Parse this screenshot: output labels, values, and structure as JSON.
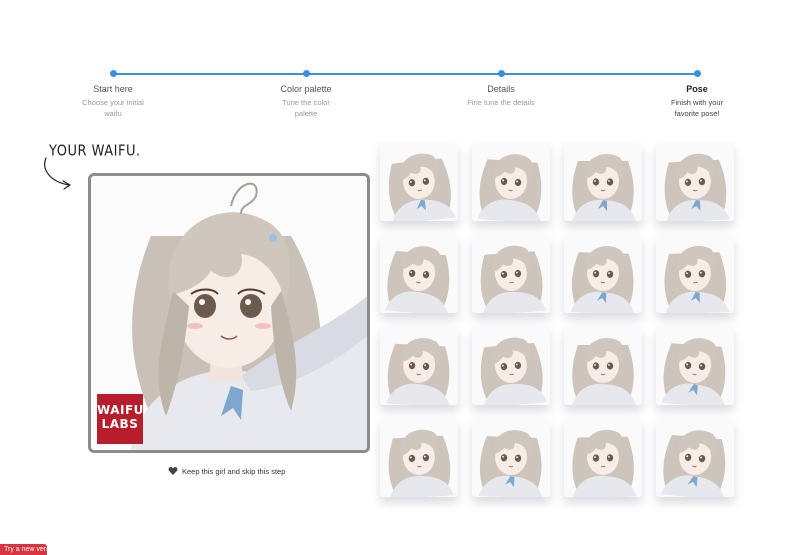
{
  "stepper": {
    "steps": [
      {
        "title": "Start here",
        "desc": "Choose your initial waifu",
        "active": false
      },
      {
        "title": "Color palette",
        "desc": "Tune the color palette",
        "active": false
      },
      {
        "title": "Details",
        "desc": "Fine tune the details",
        "active": false
      },
      {
        "title": "Pose",
        "desc": "Finish with your favorite pose!",
        "active": true
      }
    ],
    "accent_color": "#3a8ee6"
  },
  "heading": "YOUR WAIFU.",
  "portrait": {
    "logo_line1": "WAIFU",
    "logo_line2": "LABS",
    "logo_color": "#b81d2b"
  },
  "keep_action": {
    "icon": "heart-icon",
    "label": "Keep this girl and skip this step"
  },
  "pose_grid": {
    "rows": 4,
    "cols": 4,
    "count": 16
  },
  "corner_button": {
    "label": "Try a new version",
    "color": "#d9343f"
  }
}
